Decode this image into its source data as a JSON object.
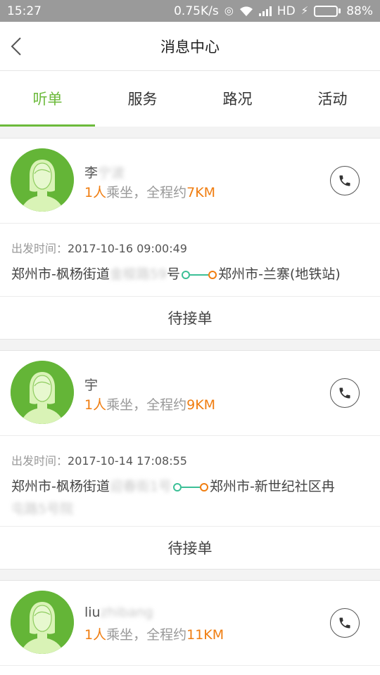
{
  "statusbar": {
    "time": "15:27",
    "speed": "0.75K/s",
    "network": "HD",
    "battery": "88%",
    "battery_level": 0.88
  },
  "nav": {
    "title": "消息中心"
  },
  "tabs": [
    {
      "label": "听单",
      "active": true
    },
    {
      "label": "服务",
      "active": false
    },
    {
      "label": "路况",
      "active": false
    },
    {
      "label": "活动",
      "active": false
    }
  ],
  "cards": [
    {
      "name": "李",
      "name_blurred": "宁波",
      "passengers": "1人",
      "summary_mid": "乘坐，全程约",
      "distance": "7KM",
      "departure_label": "出发时间：",
      "departure_time": "2017-10-16 09:00:49",
      "from_prefix": "郑州市-枫杨街道",
      "from_blurred": "金梭路59",
      "from_suffix": "号",
      "to": "郑州市-兰寨(地铁站)",
      "status": "待接单"
    },
    {
      "name": "宇",
      "name_blurred": "",
      "passengers": "1人",
      "summary_mid": "乘坐，全程约",
      "distance": "9KM",
      "departure_label": "出发时间：",
      "departure_time": "2017-10-14 17:08:55",
      "from_prefix": "郑州市-枫杨街道",
      "from_blurred": "迎春街1号",
      "from_suffix": "",
      "to": "郑州市-新世纪社区冉",
      "to_blurred": "屯路5号院",
      "status": "待接单"
    },
    {
      "name": "liu",
      "name_blurred": "zhibang",
      "passengers": "1人",
      "summary_mid": "乘坐，全程约",
      "distance": "11KM"
    }
  ]
}
